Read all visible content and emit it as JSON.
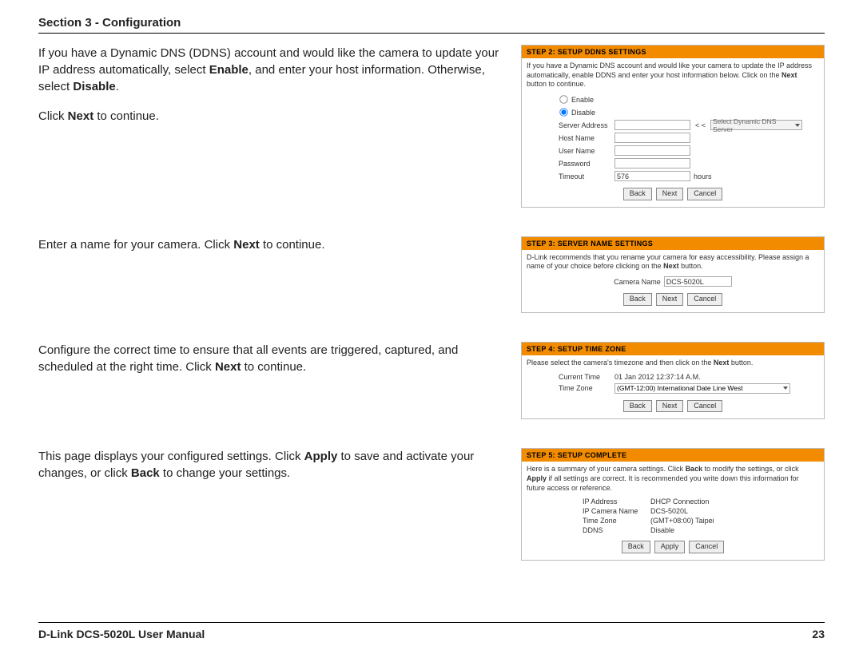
{
  "header": "Section 3 - Configuration",
  "footer": {
    "left": "D-Link DCS-5020L User Manual",
    "right": "23"
  },
  "blocks": [
    {
      "instr": {
        "p1a": "If you have a Dynamic DNS (DDNS) account and would like the camera to update your IP address automatically, select ",
        "p1b": "Enable",
        "p1c": ", and enter your host information. Otherwise, select ",
        "p1d": "Disable",
        "p1e": ".",
        "p2a": "Click ",
        "p2b": "Next",
        "p2c": " to continue."
      },
      "panel": {
        "title": "STEP 2: SETUP DDNS SETTINGS",
        "note1": "If you have a Dynamic DNS account and would like your camera to update the IP address automatically, enable DDNS and enter your host information below. Click on the ",
        "note1b": "Next",
        "note1c": " button to continue.",
        "enable": "Enable",
        "disable": "Disable",
        "server_address": "Server Address",
        "select_dns": "Select Dynamic DNS Server",
        "lessless": "< <",
        "host_name": "Host Name",
        "user_name": "User Name",
        "password": "Password",
        "timeout": "Timeout",
        "timeout_val": "576",
        "hours": "hours",
        "back": "Back",
        "next": "Next",
        "cancel": "Cancel"
      }
    },
    {
      "instr": {
        "p1a": "Enter a name for your camera. Click ",
        "p1b": "Next",
        "p1c": " to continue."
      },
      "panel": {
        "title": "STEP 3: SERVER NAME SETTINGS",
        "note1": "D-Link recommends that you rename your camera for easy accessibility. Please assign a name of your choice before clicking on the ",
        "note1b": "Next",
        "note1c": " button.",
        "cam_label": "Camera Name",
        "cam_val": "DCS-5020L",
        "back": "Back",
        "next": "Next",
        "cancel": "Cancel"
      }
    },
    {
      "instr": {
        "p1a": "Configure the correct time to ensure that all events are triggered, captured, and scheduled at the right time. Click ",
        "p1b": "Next",
        "p1c": " to continue."
      },
      "panel": {
        "title": "STEP 4: SETUP TIME ZONE",
        "note1": "Please select the camera's timezone and then click on the ",
        "note1b": "Next",
        "note1c": " button.",
        "cur_time_l": "Current Time",
        "cur_time_v": "01 Jan 2012 12:37:14 A.M.",
        "tz_l": "Time Zone",
        "tz_v": "(GMT-12:00) International Date Line West",
        "back": "Back",
        "next": "Next",
        "cancel": "Cancel"
      }
    },
    {
      "instr": {
        "p1a": "This page displays your configured settings. Click ",
        "p1b": "Apply",
        "p1c": " to save and activate your changes, or click ",
        "p1d": "Back",
        "p1e": " to change your settings."
      },
      "panel": {
        "title": "STEP 5: SETUP COMPLETE",
        "note1": "Here is a summary of your camera settings. Click ",
        "note1b": "Back",
        "note1c": " to modify the settings, or click ",
        "note1d": "Apply",
        "note1e": " if all settings are correct. It is recommended you write down this information for future access or reference.",
        "ip_l": "IP Address",
        "ip_v": "DHCP Connection",
        "cam_l": "IP Camera Name",
        "cam_v": "DCS-5020L",
        "tz_l": "Time Zone",
        "tz_v": "(GMT+08:00) Taipei",
        "ddns_l": "DDNS",
        "ddns_v": "Disable",
        "back": "Back",
        "apply": "Apply",
        "cancel": "Cancel"
      }
    }
  ]
}
